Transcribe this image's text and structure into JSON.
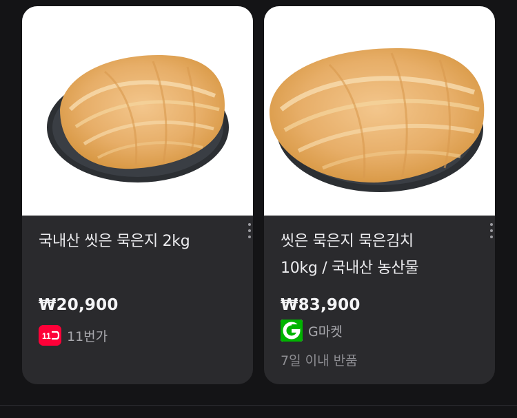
{
  "products": [
    {
      "title_lines": [
        "국내산 씻은 묵은지 2kg"
      ],
      "price": "₩20,900",
      "seller": "11번가",
      "seller_logo_text": "11",
      "return_policy": ""
    },
    {
      "title_lines": [
        "씻은 묵은지 묵은김치",
        "10kg / 국내산 농산물"
      ],
      "price": "₩83,900",
      "seller": "G마켓",
      "seller_logo_text": "G",
      "return_policy": "7일 이내 반품"
    }
  ],
  "colors": {
    "background": "#141416",
    "card": "#2a2a2d",
    "elevenst_brand": "#ff0038",
    "gmarket_brand": "#00b400"
  },
  "icons": {
    "more": "vertical-dots-icon",
    "elevenst_logo": "11st-logo-icon",
    "gmarket_logo": "gmarket-logo-icon"
  }
}
